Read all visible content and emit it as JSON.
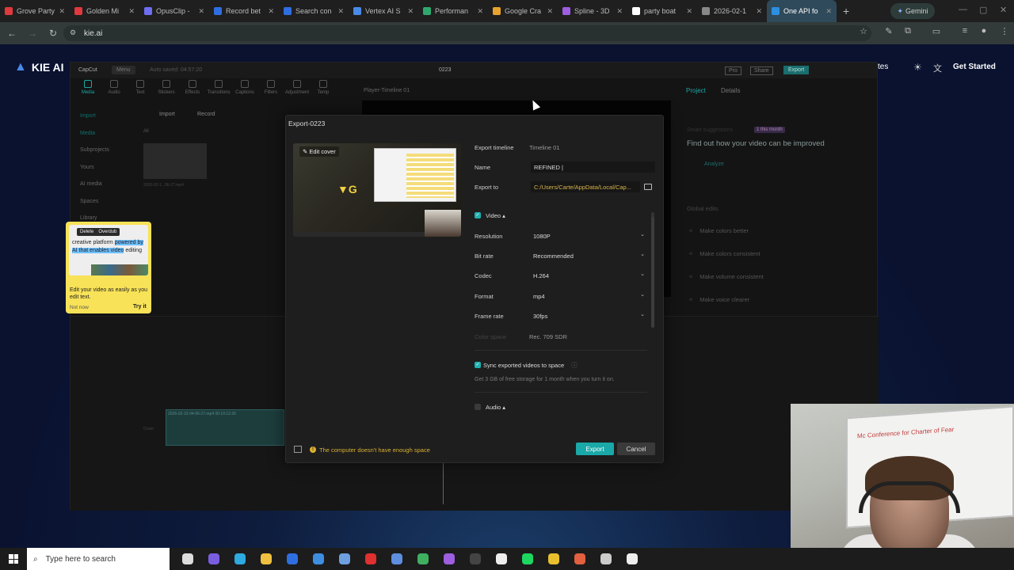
{
  "browser": {
    "tabs": [
      {
        "label": "Grove Party",
        "color": "#e0393e"
      },
      {
        "label": "Golden Mi",
        "color": "#e0393e"
      },
      {
        "label": "OpusClip -",
        "color": "#6e6ef0"
      },
      {
        "label": "Record bet",
        "color": "#2e6ee0"
      },
      {
        "label": "Search con",
        "color": "#2e6ee0"
      },
      {
        "label": "Vertex AI S",
        "color": "#4a8ae8"
      },
      {
        "label": "Performan",
        "color": "#2ea86e"
      },
      {
        "label": "Google Cra",
        "color": "#e8a32e"
      },
      {
        "label": "Spline - 3D",
        "color": "#9e5ee0"
      },
      {
        "label": "party boat",
        "color": "#ffffff"
      },
      {
        "label": "2026-02-1",
        "color": "#888888"
      },
      {
        "label": "One API fo",
        "color": "#2e8ee0"
      }
    ],
    "active_tab": 11,
    "gemini_label": "Gemini",
    "url": "kie.ai"
  },
  "site": {
    "logo_text": "KIE AI",
    "nav_partial": "tes",
    "get_started": "Get Started"
  },
  "capcut": {
    "menu_label": "Menu",
    "autosave": "Auto saved: 04:57:20",
    "project_title": "0223",
    "pro_label": "Pro",
    "share_label": "Share",
    "export_top_label": "Export",
    "player_title": "Player-Timeline 01",
    "tools": [
      "Media",
      "Audio",
      "Text",
      "Stickers",
      "Effects",
      "Transitions",
      "Captions",
      "Filters",
      "Adjustment",
      "Temp"
    ],
    "side_items": [
      "Import",
      "Media",
      "Subprojects",
      "Yours",
      "AI media",
      "Spaces",
      "Library"
    ],
    "import_btn": "Import",
    "record_btn": "Record",
    "all_label": "All",
    "media_item": "2026-02-1...06-27.mp4",
    "right_tabs": [
      "Project",
      "Details"
    ],
    "smart_suggestions": "Smart suggestions",
    "smart_badge": "1 this month",
    "smart_headline": "Find out how your video can be improved",
    "analyze": "Analyze",
    "global_edits": "Global edits",
    "edits": [
      "Make colors better",
      "Make colors consistent",
      "Make volume consistent",
      "Make voice clearer"
    ],
    "timeline_clip": "2026-02-19 04-06-27.mp4  00:10:12:26",
    "cover_label": "Cover"
  },
  "tooltip": {
    "delete": "Delete",
    "overdub": "Overdub",
    "text_pre": "creative platform ",
    "text_hl": "powered by AI that enables video",
    "text_post": " editing",
    "desc": "Edit your video as easily as you edit text.",
    "not_now": "Not now",
    "try_it": "Try it"
  },
  "export_dialog": {
    "title": "Export-0223",
    "edit_cover": "Edit cover",
    "export_timeline_label": "Export timeline",
    "export_timeline_value": "Timeline 01",
    "name_label": "Name",
    "name_value": "REFINED |",
    "export_to_label": "Export to",
    "export_to_value": "C:/Users/Carte/AppData/Local/Cap...",
    "video_section": "Video",
    "resolution_label": "Resolution",
    "resolution_value": "1080P",
    "bitrate_label": "Bit rate",
    "bitrate_value": "Recommended",
    "codec_label": "Codec",
    "codec_value": "H.264",
    "format_label": "Format",
    "format_value": "mp4",
    "framerate_label": "Frame rate",
    "framerate_value": "30fps",
    "colorspace_label": "Color space",
    "colorspace_value": "Rec. 709 SDR",
    "sync_label": "Sync exported videos to space",
    "sync_desc": "Get 3 GB of free storage for 1 month when you turn it on.",
    "audio_section": "Audio",
    "warning": "The computer doesn't have enough space",
    "export_btn": "Export",
    "cancel_btn": "Cancel"
  },
  "webcam": {
    "whiteboard_text": "Mc Conference for Charter of Fear"
  },
  "taskbar": {
    "search_placeholder": "Type here to search",
    "apps": [
      "task-view",
      "copilot",
      "edge",
      "file-explorer",
      "mail",
      "store",
      "app",
      "opera",
      "app2",
      "chrome",
      "app3",
      "obs",
      "capcut",
      "spotify",
      "chrome2",
      "app4",
      "app5",
      "capcut2"
    ],
    "app_colors": [
      "#ddd",
      "#7a5ee0",
      "#2eaae0",
      "#f0c040",
      "#2e6ee0",
      "#3e8ee0",
      "#6ea0e0",
      "#e03030",
      "#5e8ee0",
      "#3eb060",
      "#9e5ee0",
      "#444",
      "#eee",
      "#1ed760",
      "#e8c02e",
      "#e06040",
      "#ccc",
      "#eee"
    ]
  }
}
